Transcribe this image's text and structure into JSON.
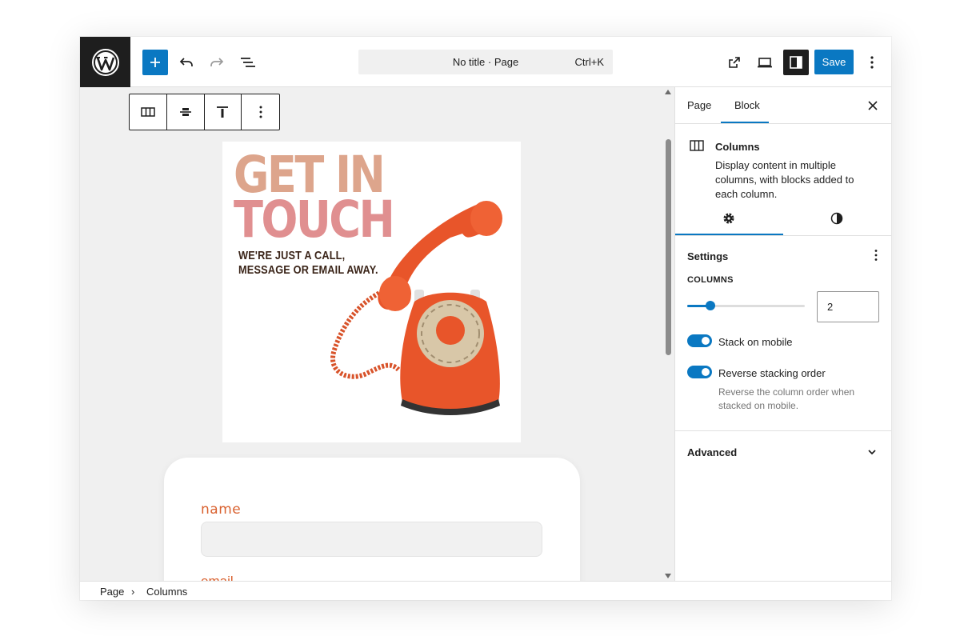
{
  "toolbar": {
    "add_icon": "plus-icon",
    "undo_icon": "undo-icon",
    "redo_icon": "redo-icon",
    "list_icon": "list-view-icon",
    "command_title": "No title · Page",
    "command_shortcut": "Ctrl+K",
    "view_icon": "external-link-icon",
    "preview_icon": "desktop-icon",
    "settings_icon": "sidebar-settings-icon",
    "save_label": "Save",
    "more_icon": "more-vertical-icon"
  },
  "block_toolbar": {
    "items": [
      "columns-icon",
      "align-vertical-center-icon",
      "align-top-icon",
      "more-vertical-icon"
    ]
  },
  "hero": {
    "title_line1": "GET IN",
    "title_line2": "TOUCH",
    "subtitle_line1": "WE'RE JUST A CALL,",
    "subtitle_line2": "MESSAGE OR EMAIL AWAY."
  },
  "form": {
    "label_name": "name",
    "label_email": "email"
  },
  "sidebar": {
    "tabs": [
      "Page",
      "Block"
    ],
    "active_tab": "Block",
    "block_card": {
      "title": "Columns",
      "description": "Display content in multiple columns, with blocks added to each column."
    },
    "settings_title": "Settings",
    "columns_label": "COLUMNS",
    "columns_value": "2",
    "columns_level": 0.2,
    "stack_on_mobile_label": "Stack on mobile",
    "stack_on_mobile": true,
    "reverse_label": "Reverse stacking order",
    "reverse": true,
    "reverse_help": "Reverse the column order when stacked on mobile.",
    "advanced_label": "Advanced"
  },
  "breadcrumb": {
    "items": [
      "Page",
      "Columns"
    ],
    "separator": "›"
  },
  "colors": {
    "accent": "#0a78c2",
    "dark": "#1e1e1e",
    "form_label": "#d9612f",
    "phone": "#e85a2a"
  }
}
